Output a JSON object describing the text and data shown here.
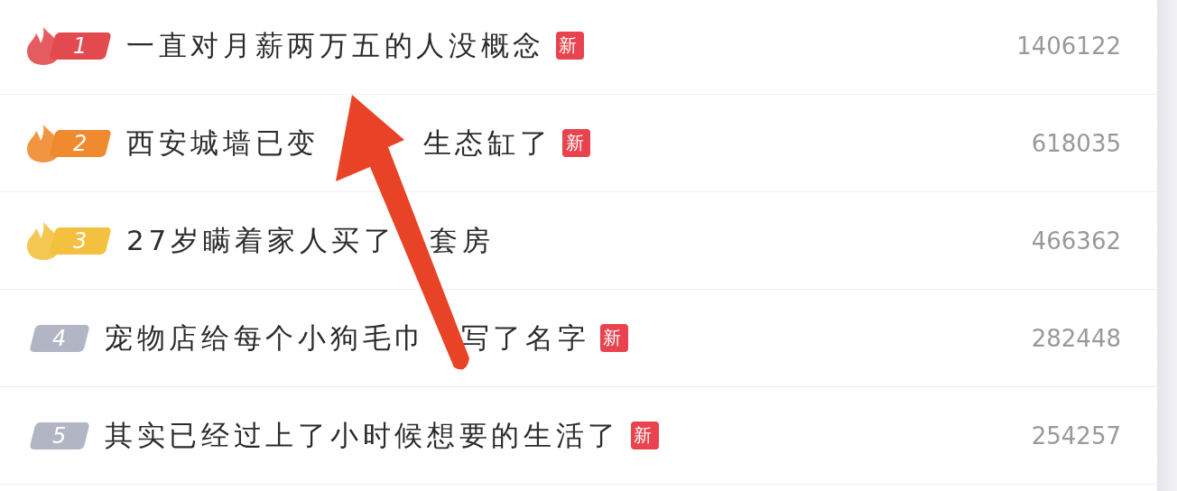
{
  "items": [
    {
      "rank": "1",
      "kind": "hot",
      "color": "#e24a4f",
      "title_parts": [
        "一直对月薪两万五的人没概念"
      ],
      "tag": "新",
      "count": "1406122"
    },
    {
      "rank": "2",
      "kind": "hot",
      "color": "#f08a2e",
      "title_parts": [
        "西安城墙已变",
        "生态缸了"
      ],
      "tag": "新",
      "count": "618035"
    },
    {
      "rank": "3",
      "kind": "hot",
      "color": "#f3c03f",
      "title_parts": [
        "27岁瞒着家人买了",
        "套房"
      ],
      "count": "466362"
    },
    {
      "rank": "4",
      "kind": "plain",
      "color": "#b1b5c4",
      "title_parts": [
        "宠物店给每个小狗毛巾",
        "写了名字"
      ],
      "tag": "新",
      "count": "282448"
    },
    {
      "rank": "5",
      "kind": "plain",
      "color": "#b1b5c4",
      "title_parts": [
        "其实已经过上了小时候想要的生活了"
      ],
      "tag": "新",
      "count": "254257"
    }
  ]
}
